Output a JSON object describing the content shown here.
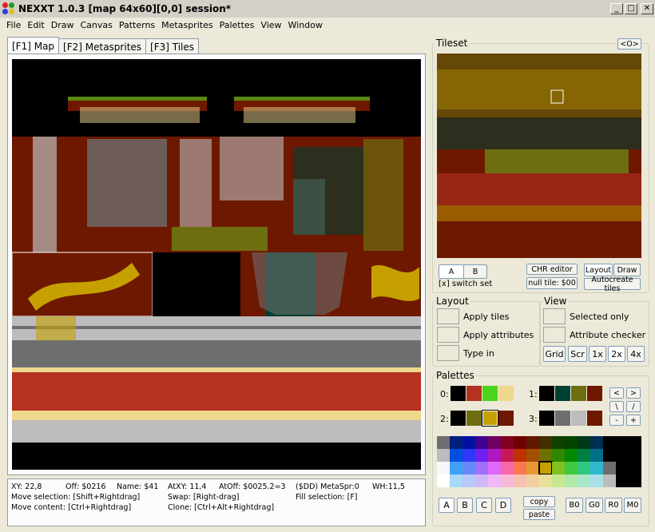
{
  "window": {
    "title": "NEXXT 1.0.3  [map 64x60][0,0] session*",
    "min": "_",
    "max": "□",
    "close": "✕"
  },
  "menu": [
    "File",
    "Edit",
    "Draw",
    "Canvas",
    "Patterns",
    "Metasprites",
    "Palettes",
    "View",
    "Window"
  ],
  "tabs": [
    "[F1] Map",
    "[F2] Metasprites",
    "[F3] Tiles"
  ],
  "status": {
    "row1": [
      "XY: 22,8",
      "Off: $0216",
      "Name: $41",
      "AtXY: 11,4",
      "AtOff: $0025.2=3",
      "($DD) MetaSpr:0",
      "WH:11,5"
    ],
    "row2": [
      "Move selection: [Shift+Rightdrag]",
      "Swap: [Right-drag]",
      "Fill selection: [F]"
    ],
    "row3": [
      "Move content: [Ctrl+Rightdrag]",
      "Clone: [Ctrl+Alt+Rightdrag]"
    ]
  },
  "tileset": {
    "title": "Tileset",
    "nav": "<O>",
    "bankA": "A",
    "bankB": "B",
    "switch": "[x] switch set",
    "chr_editor": "CHR editor",
    "null_tile": "null tile: $00",
    "layout": "Layout",
    "draw": "Draw",
    "autocreate": "Autocreate tiles"
  },
  "layout": {
    "title": "Layout",
    "apply_tiles": "Apply tiles",
    "apply_attributes": "Apply attributes",
    "type_in": "Type in"
  },
  "view": {
    "title": "View",
    "selected_only": "Selected only",
    "attribute_checker": "Attribute checker",
    "grid": "Grid",
    "scr": "Scr",
    "x1": "1x",
    "x2": "2x",
    "x4": "4x"
  },
  "palettes": {
    "title": "Palettes",
    "sets": [
      {
        "label": "0:",
        "colors": [
          "#000000",
          "#b53120",
          "#4cd41c",
          "#eed88d"
        ]
      },
      {
        "label": "1:",
        "colors": [
          "#000000",
          "#004030",
          "#6e6e10",
          "#6e1800"
        ]
      },
      {
        "label": "2:",
        "colors": [
          "#000000",
          "#6e6e10",
          "#c5a000",
          "#6e1800"
        ]
      },
      {
        "label": "3:",
        "colors": [
          "#000000",
          "#6e6e6e",
          "#bcbcbc",
          "#6e1800"
        ]
      }
    ],
    "nav": [
      "<",
      ">",
      "\\",
      "/",
      "-",
      "+"
    ],
    "subs": [
      "A",
      "B",
      "C",
      "D"
    ],
    "copy": "copy",
    "paste": "paste",
    "ops": [
      "B0",
      "G0",
      "R0",
      "M0"
    ]
  }
}
